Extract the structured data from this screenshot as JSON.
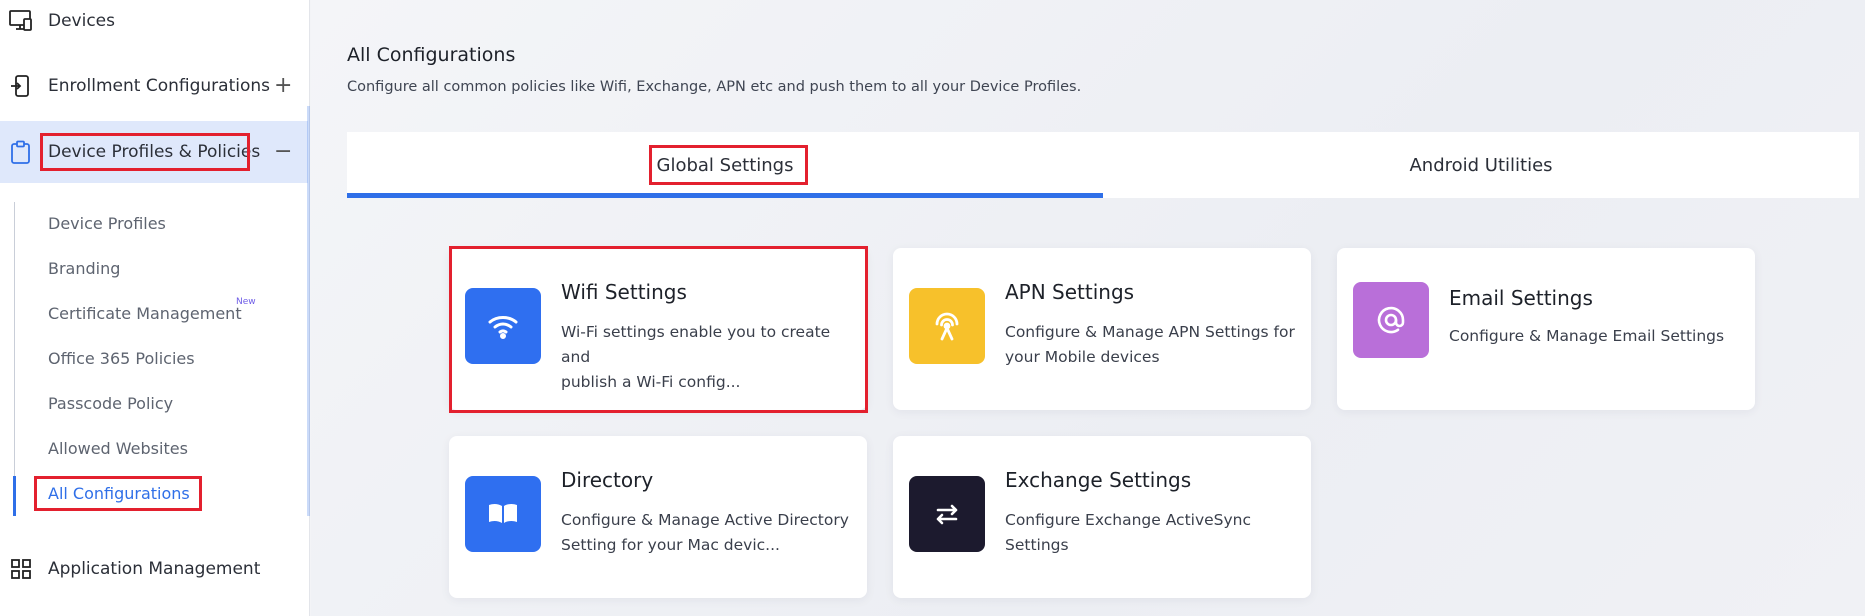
{
  "sidebar": {
    "items": [
      {
        "label": "Devices",
        "icon": "monitor-icon"
      },
      {
        "label": "Enrollment Configurations",
        "icon": "phone-enroll-icon",
        "toggle": "+"
      },
      {
        "label": "Device Profiles & Policies",
        "icon": "clipboard-icon",
        "toggle": "−"
      },
      {
        "label": "Application Management",
        "icon": "grid-icon"
      }
    ],
    "sub_items": [
      {
        "label": "Device Profiles"
      },
      {
        "label": "Branding"
      },
      {
        "label": "Certificate Management",
        "badge": "New"
      },
      {
        "label": "Office 365 Policies"
      },
      {
        "label": "Passcode Policy"
      },
      {
        "label": "Allowed Websites"
      },
      {
        "label": "All Configurations"
      }
    ]
  },
  "main": {
    "title": "All Configurations",
    "subtitle": "Configure all common policies like Wifi, Exchange, APN etc and push them to all your Device Profiles.",
    "tabs": [
      {
        "label": "Global Settings",
        "active": true
      },
      {
        "label": "Android Utilities",
        "active": false
      }
    ],
    "cards": [
      {
        "title": "Wifi Settings",
        "desc_line1": "Wi-Fi settings enable you to create and",
        "desc_line2": "publish a Wi-Fi config...",
        "icon": "wifi-icon",
        "color": "#2f6ff0"
      },
      {
        "title": "APN Settings",
        "desc_line1": "Configure & Manage APN Settings for",
        "desc_line2": "your Mobile devices",
        "icon": "antenna-icon",
        "color": "#f7c12b"
      },
      {
        "title": "Email Settings",
        "desc_line1": "Configure & Manage Email Settings",
        "desc_line2": "",
        "icon": "at-sign-icon",
        "color": "#b96fd9"
      },
      {
        "title": "Directory",
        "desc_line1": "Configure & Manage Active Directory",
        "desc_line2": "Setting for your Mac devic...",
        "icon": "book-icon",
        "color": "#2f6ff0"
      },
      {
        "title": "Exchange Settings",
        "desc_line1": "Configure Exchange ActiveSync",
        "desc_line2": "Settings",
        "icon": "swap-arrows-icon",
        "color": "#1c1a2e"
      }
    ]
  },
  "colors": {
    "accent": "#2f6fe8",
    "highlight": "#e3202e",
    "active_bg": "#dfe8fb"
  }
}
